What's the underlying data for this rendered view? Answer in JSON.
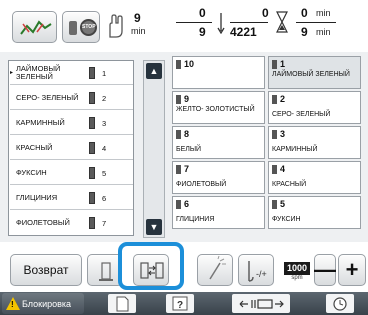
{
  "status": {
    "stitch_count": "9",
    "stitch_unit": "min",
    "color_done": "0",
    "color_total": "9",
    "stitch_done": "0",
    "stitch_total": "4221",
    "time_done": "0",
    "time_done_unit": "min",
    "time_total": "9",
    "time_total_unit": "min"
  },
  "color_list": [
    {
      "name": "ЛАЙМОВЫЙ ЗЕЛЕНЫЙ",
      "index": "1",
      "selected": true
    },
    {
      "name": "СЕРО- ЗЕЛЕНЫЙ",
      "index": "2",
      "selected": false
    },
    {
      "name": "КАРМИННЫЙ",
      "index": "3",
      "selected": false
    },
    {
      "name": "КРАСНЫЙ",
      "index": "4",
      "selected": false
    },
    {
      "name": "ФУКСИН",
      "index": "5",
      "selected": false
    },
    {
      "name": "ГЛИЦИНИЯ",
      "index": "6",
      "selected": false
    },
    {
      "name": "ФИОЛЕТОВЫЙ",
      "index": "7",
      "selected": false
    }
  ],
  "grid": {
    "left": [
      {
        "num": "10",
        "name": ""
      },
      {
        "num": "9",
        "name": "ЖЕЛТО- ЗОЛОТИСТЫЙ"
      },
      {
        "num": "8",
        "name": "БЕЛЫЙ"
      },
      {
        "num": "7",
        "name": "ФИОЛЕТОВЫЙ"
      },
      {
        "num": "6",
        "name": "ГЛИЦИНИЯ"
      }
    ],
    "right": [
      {
        "num": "1",
        "name": "ЛАЙМОВЫЙ ЗЕЛЕНЫЙ"
      },
      {
        "num": "2",
        "name": "СЕРО- ЗЕЛЕНЫЙ"
      },
      {
        "num": "3",
        "name": "КАРМИННЫЙ"
      },
      {
        "num": "4",
        "name": "КРАСНЫЙ"
      },
      {
        "num": "5",
        "name": "ФУКСИН"
      }
    ]
  },
  "buttons": {
    "back": "Возврат",
    "speed_value": "1000",
    "speed_unit": "spm",
    "minus": "—",
    "plus": "+"
  },
  "footer": {
    "lock": "Блокировка"
  },
  "colors": {
    "highlight": "#1c8fd9",
    "footer": "#39424a",
    "warning": "#f3c400"
  }
}
